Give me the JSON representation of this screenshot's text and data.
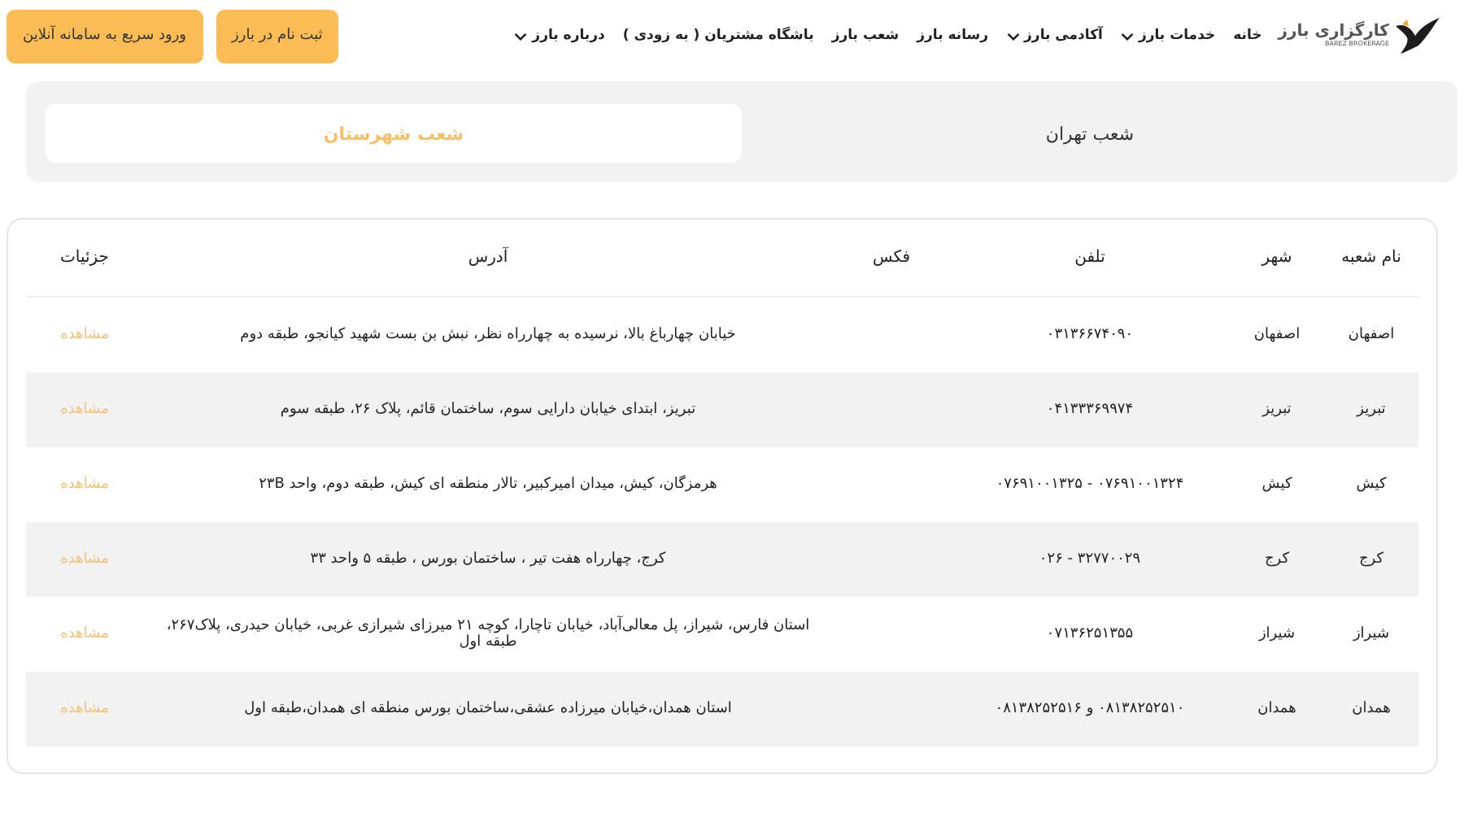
{
  "header": {
    "logo": {
      "name": "کارگزاری بارز",
      "tagline": "BAREZ BROKERAGE"
    },
    "nav": [
      {
        "label": "خانه",
        "has_dropdown": false
      },
      {
        "label": "خدمات بارز",
        "has_dropdown": true
      },
      {
        "label": "آکادمی بارز",
        "has_dropdown": true
      },
      {
        "label": "رسانه بارز",
        "has_dropdown": false
      },
      {
        "label": "شعب بارز",
        "has_dropdown": false
      },
      {
        "label": "باشگاه مشتریان ( به زودی )",
        "has_dropdown": false
      },
      {
        "label": "درباره بارز",
        "has_dropdown": true
      }
    ],
    "buttons": [
      "ثبت نام در بارز",
      "ورود سریع به سامانه آنلاین"
    ]
  },
  "tabs": [
    {
      "label": "شعب تهران",
      "selected": false
    },
    {
      "label": "شعب شهرستان",
      "selected": true
    }
  ],
  "table": {
    "columns": [
      "نام شعبه",
      "شهر",
      "تلفن",
      "فکس",
      "آدرس",
      "جزئیات"
    ],
    "rows": [
      {
        "branch": "اصفهان",
        "city": "اصفهان",
        "phone": "۰۳۱۳۶۶۷۴۰۹۰",
        "address": "خیابان چهارباغ بالا، نرسیده به چهارراه نظر، نبش بن بست شهید کیانجو، طبقه دوم",
        "details": "مشاهده"
      },
      {
        "branch": "تبریز",
        "city": "تبریز",
        "phone": "۰۴۱۳۳۳۶۹۹۷۴",
        "address": "تبریز، ابتدای خیابان دارایی سوم، ساختمان قائم، پلاک ۲۶، طبقه سوم",
        "details": "مشاهده"
      },
      {
        "branch": "کیش",
        "city": "کیش",
        "phone": "۰۷۶۹۱۰۰۱۳۲۴ - ۰۷۶۹۱۰۰۱۳۲۵",
        "address": "هرمزگان، کیش، میدان امیرکبیر، تالار منطقه ای کیش، طبقه دوم، واحد ۲۳B",
        "details": "مشاهده"
      },
      {
        "branch": "کرج",
        "city": "کرج",
        "phone": "۳۲۷۷۰۰۲۹ - ۰۲۶",
        "address": "کرج، چهارراه هفت تیر ، ساختمان بورس ، طبقه ۵ واحد ۳۳",
        "details": "مشاهده"
      },
      {
        "branch": "شیراز",
        "city": "شیراز",
        "phone": "۰۷۱۳۶۲۵۱۳۵۵",
        "address": "استان فارس، شیراز، پل معالی‌آباد، خیابان تاچارا، کوچه ۲۱ میرزای شیرازی غربی، خیابان حیدری، پلاک۲۶۷، طبقه اول",
        "details": "مشاهده"
      },
      {
        "branch": "همدان",
        "city": "همدان",
        "phone": "۰۸۱۳۸۲۵۲۵۱۰ و ۰۸۱۳۸۲۵۲۵۱۶",
        "address": "استان همدان،خیابان میرزاده عشقی،ساختمان بورس منطقه ای همدان،طبقه اول",
        "details": "مشاهده"
      }
    ]
  }
}
